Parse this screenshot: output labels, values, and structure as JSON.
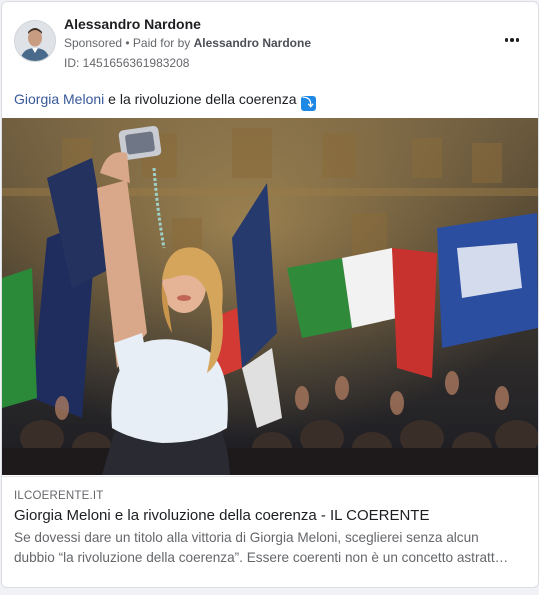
{
  "post": {
    "author_name": "Alessandro Nardone",
    "sponsored_label": "Sponsored",
    "separator": " • ",
    "paid_for_prefix": "Paid for by ",
    "paid_for_name": "Alessandro Nardone",
    "ad_id": "ID: 1451656361983208",
    "more_icon": "more-horizontal-icon"
  },
  "body": {
    "link_text": "Giorgia Meloni",
    "rest_text": " e la rivoluzione della coerenza",
    "emoji_icon": "arrow-right-hook-emoji",
    "emoji_glyph": "⤵"
  },
  "link_preview": {
    "domain": "ILCOERENTE.IT",
    "title": "Giorgia Meloni e la rivoluzione della coerenza - IL COERENTE",
    "description_line1": "Se dovessi dare un titolo alla vittoria di Giorgia Meloni, sceglierei senza alcun",
    "description_line2": "dubbio “la rivoluzione della coerenza”. Essere coerenti non è un concetto astratt…"
  },
  "colors": {
    "link": "#385898",
    "secondary_text": "#65676b",
    "emoji_bg": "#1e88e5"
  }
}
